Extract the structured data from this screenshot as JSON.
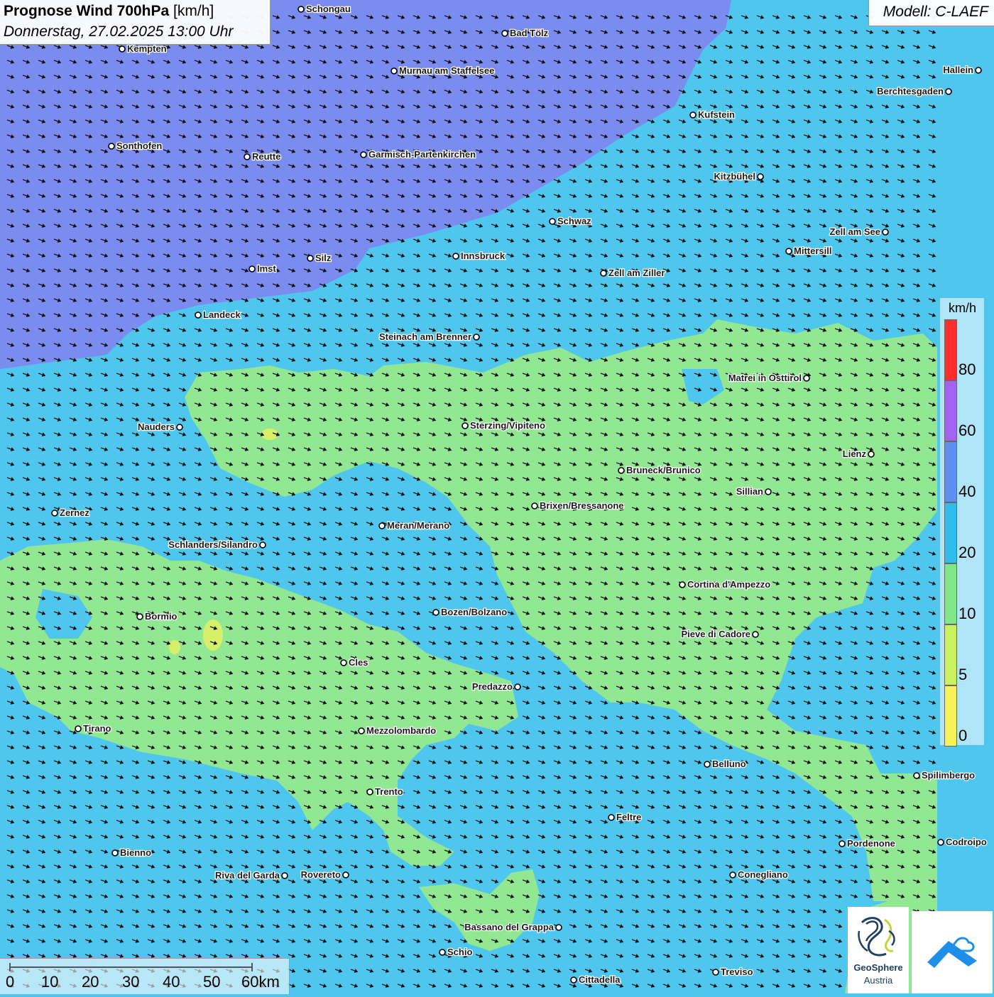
{
  "title": {
    "bold": "Prognose Wind 700hPa",
    "unit": "[km/h]",
    "datetime": "Donnerstag, 27.02.2025 13:00 Uhr"
  },
  "model": "Modell: C-LAEF",
  "legend": {
    "unit": "km/h",
    "labels": [
      "80",
      "60",
      "40",
      "20",
      "10",
      "5",
      "0"
    ],
    "colors": [
      "#ff2d2d",
      "#a263f0",
      "#5f8ff0",
      "#2fbcef",
      "#7ee889",
      "#c9f25a",
      "#f7f259"
    ]
  },
  "scale": {
    "labels": [
      "0",
      "10",
      "20",
      "30",
      "40",
      "50",
      "60km"
    ]
  },
  "map_colors": {
    "purple": "#7b8cf0",
    "blue": "#4fc6ee",
    "green": "#92e892",
    "yellow": "#d8ef6a"
  },
  "cities": [
    {
      "name": "Schongau",
      "label_side": "right"
    },
    {
      "name": "Bad Tölz",
      "label_side": "right"
    },
    {
      "name": "Kempten",
      "label_side": "right"
    },
    {
      "name": "Murnau am Staffelsee",
      "label_side": "right"
    },
    {
      "name": "Hallein",
      "label_side": "left"
    },
    {
      "name": "Berchtesgaden",
      "label_side": "left"
    },
    {
      "name": "Kufstein",
      "label_side": "right"
    },
    {
      "name": "Sonthofen",
      "label_side": "right"
    },
    {
      "name": "Reutte",
      "label_side": "right"
    },
    {
      "name": "Garmisch-Partenkirchen",
      "label_side": "right"
    },
    {
      "name": "Kitzbühel",
      "label_side": "left"
    },
    {
      "name": "Schwaz",
      "label_side": "right"
    },
    {
      "name": "Zell am See",
      "label_side": "left"
    },
    {
      "name": "Mittersill",
      "label_side": "right"
    },
    {
      "name": "Silz",
      "label_side": "right"
    },
    {
      "name": "Innsbruck",
      "label_side": "right"
    },
    {
      "name": "Imst",
      "label_side": "right"
    },
    {
      "name": "Zell am Ziller",
      "label_side": "right"
    },
    {
      "name": "Landeck",
      "label_side": "right"
    },
    {
      "name": "Steinach am Brenner",
      "label_side": "left"
    },
    {
      "name": "Matrei in Osttirol",
      "label_side": "left"
    },
    {
      "name": "Nauders",
      "label_side": "left"
    },
    {
      "name": "Sterzing/Vipiteno",
      "label_side": "right"
    },
    {
      "name": "Lienz",
      "label_side": "left"
    },
    {
      "name": "Bruneck/Brunico",
      "label_side": "right"
    },
    {
      "name": "Sillian",
      "label_side": "left"
    },
    {
      "name": "Brixen/Bressanone",
      "label_side": "right"
    },
    {
      "name": "Zernez",
      "label_side": "right"
    },
    {
      "name": "Meran/Merano",
      "label_side": "right"
    },
    {
      "name": "Schlanders/Silandro",
      "label_side": "left"
    },
    {
      "name": "Cortina d'Ampezzo",
      "label_side": "right"
    },
    {
      "name": "Bozen/Bolzano",
      "label_side": "right"
    },
    {
      "name": "Bormio",
      "label_side": "right"
    },
    {
      "name": "Pieve di Cadore",
      "label_side": "left"
    },
    {
      "name": "Cles",
      "label_side": "right"
    },
    {
      "name": "Predazzo",
      "label_side": "left"
    },
    {
      "name": "Tirano",
      "label_side": "right"
    },
    {
      "name": "Mezzolombardo",
      "label_side": "right"
    },
    {
      "name": "Belluno",
      "label_side": "right"
    },
    {
      "name": "Spilimbergo",
      "label_side": "right"
    },
    {
      "name": "Trento",
      "label_side": "right"
    },
    {
      "name": "Feltre",
      "label_side": "right"
    },
    {
      "name": "Pordenone",
      "label_side": "right"
    },
    {
      "name": "Codroipo",
      "label_side": "right"
    },
    {
      "name": "Bienno",
      "label_side": "right"
    },
    {
      "name": "Riva del Garda",
      "label_side": "left"
    },
    {
      "name": "Rovereto",
      "label_side": "left"
    },
    {
      "name": "Conegliano",
      "label_side": "right"
    },
    {
      "name": "Bassano del Grappa",
      "label_side": "left"
    },
    {
      "name": "Schio",
      "label_side": "right"
    },
    {
      "name": "Treviso",
      "label_side": "right"
    },
    {
      "name": "Cittadella",
      "label_side": "right"
    }
  ],
  "logos": {
    "geosphere_line1": "GeoSphere",
    "geosphere_line2": "Austria"
  }
}
